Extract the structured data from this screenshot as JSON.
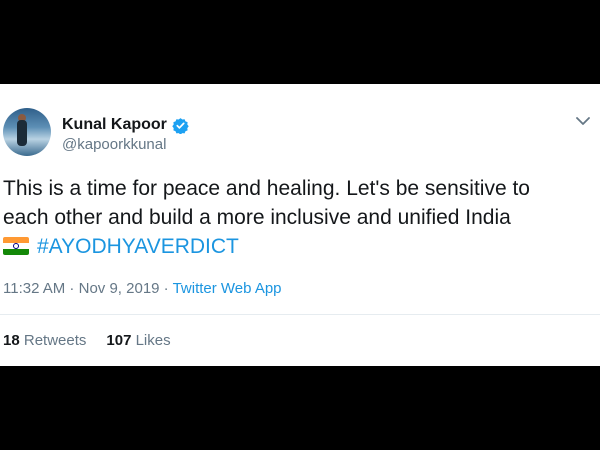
{
  "tweet": {
    "author_name": "Kunal Kapoor",
    "handle": "@kapoorkkunal",
    "text_line1": "This is a time for peace and healing. Let's be sensitive to",
    "text_line2": "each other and build a more inclusive and unified India",
    "hashtag": "#AYODHYAVERDICT",
    "time": "11:32 AM",
    "separator": " · ",
    "date": "Nov 9, 2019",
    "source_app": "Twitter Web App",
    "retweets_count": "18",
    "retweets_label": "Retweets",
    "likes_count": "107",
    "likes_label": "Likes"
  },
  "icons": {
    "verified": "verified-badge-icon",
    "menu": "chevron-down-icon",
    "flag": "india-flag-icon"
  },
  "colors": {
    "link": "#1b95e0",
    "secondary_text": "#657786",
    "primary_text": "#14171a",
    "background": "#000000",
    "card": "#ffffff"
  }
}
